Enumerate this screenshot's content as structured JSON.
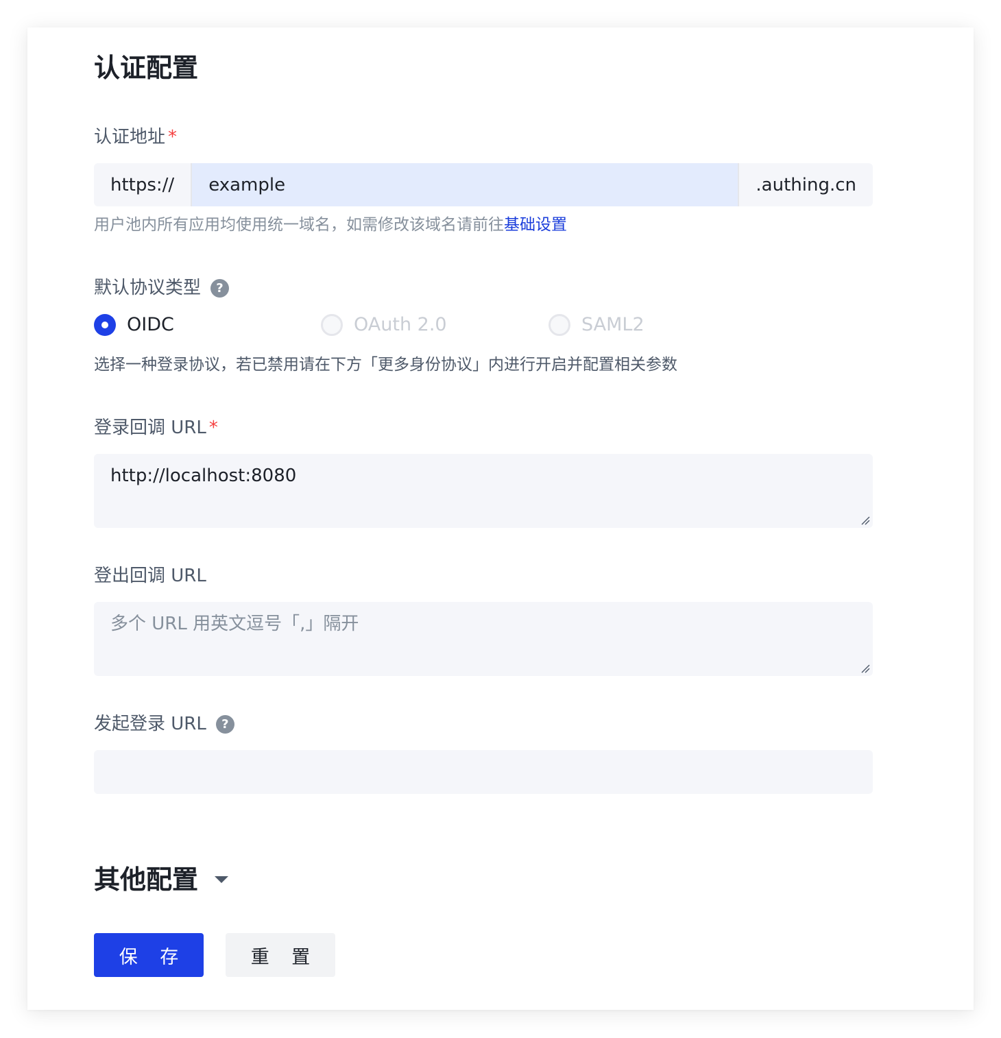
{
  "auth_section": {
    "title": "认证配置"
  },
  "auth_address": {
    "label": "认证地址",
    "required_mark": "*",
    "prefix": "https://",
    "value": "example",
    "suffix": ".authing.cn",
    "hint": "用户池内所有应用均使用统一域名，如需修改该域名请前往",
    "hint_link": "基础设置"
  },
  "protocol": {
    "label": "默认协议类型",
    "help_icon": "question-icon",
    "options": [
      {
        "label": "OIDC",
        "selected": true,
        "disabled": false
      },
      {
        "label": "OAuth 2.0",
        "selected": false,
        "disabled": true
      },
      {
        "label": "SAML2",
        "selected": false,
        "disabled": true
      }
    ],
    "hint": "选择一种登录协议，若已禁用请在下方「更多身份协议」内进行开启并配置相关参数"
  },
  "login_callback": {
    "label": "登录回调 URL",
    "required_mark": "*",
    "value": "http://localhost:8080"
  },
  "logout_callback": {
    "label": "登出回调 URL",
    "placeholder": "多个 URL 用英文逗号「,」隔开"
  },
  "initiate_login": {
    "label": "发起登录 URL",
    "help_icon": "question-icon",
    "value": ""
  },
  "other_section": {
    "title": "其他配置",
    "caret_icon": "caret-down-icon"
  },
  "actions": {
    "save_label": "保 存",
    "reset_label": "重 置"
  },
  "colors": {
    "primary": "#1e40e6",
    "link": "#1a3ddb",
    "required": "#f53f3f",
    "input_bg": "#f5f6fa",
    "input_focus_bg": "#e3ebfd"
  }
}
